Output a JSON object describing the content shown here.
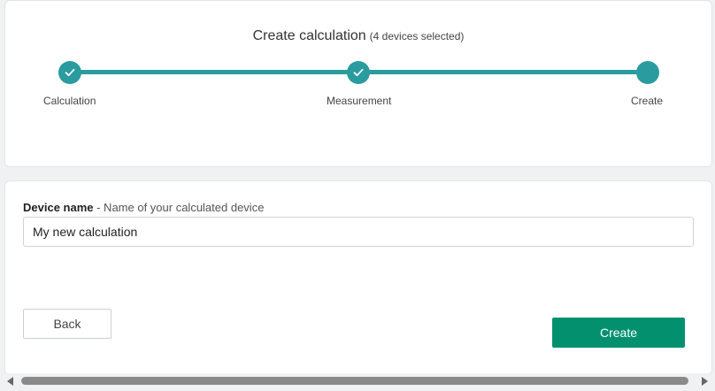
{
  "wizard": {
    "title": "Create calculation",
    "subtitle": "(4 devices selected)",
    "accent_color": "#2a9b9e",
    "steps": [
      {
        "label": "Calculation",
        "state": "completed",
        "icon": "check-icon"
      },
      {
        "label": "Measurement",
        "state": "completed",
        "icon": "check-icon"
      },
      {
        "label": "Create",
        "state": "current",
        "icon": ""
      }
    ]
  },
  "form": {
    "device_name_label": "Device name",
    "device_name_hint": " - Name of your calculated device",
    "device_name_value": "My new calculation"
  },
  "actions": {
    "back_label": "Back",
    "create_label": "Create",
    "create_color": "#02906f"
  }
}
